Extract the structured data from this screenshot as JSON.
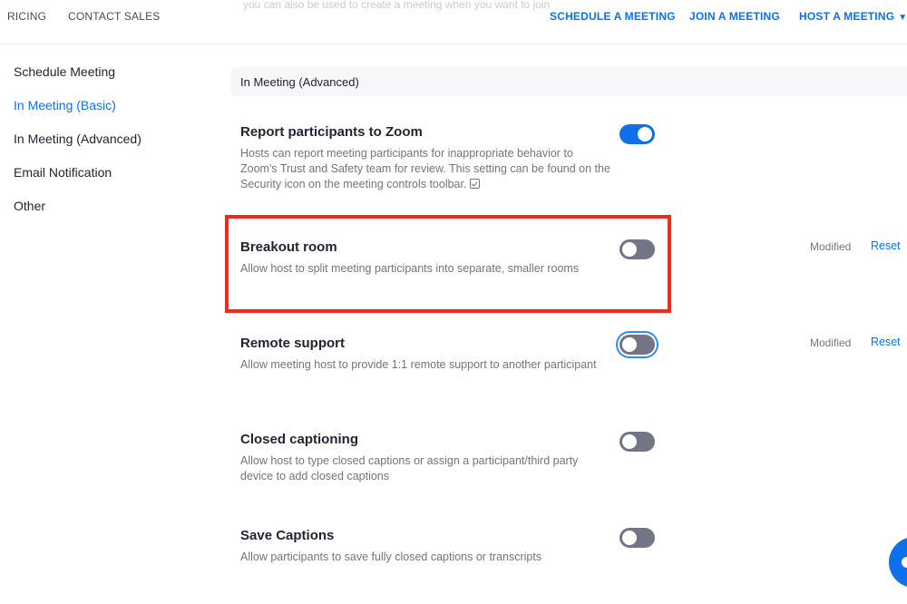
{
  "topnav": {
    "left_links": [
      "RICING",
      "CONTACT SALES"
    ],
    "right_links": [
      "SCHEDULE A MEETING",
      "JOIN A MEETING",
      "HOST A MEETING"
    ],
    "faded_banner_text": "you can also be used to create a meeting when you want to join"
  },
  "sidebar": {
    "items": [
      {
        "label": "Schedule Meeting",
        "active": false
      },
      {
        "label": "In Meeting (Basic)",
        "active": true
      },
      {
        "label": "In Meeting (Advanced)",
        "active": false
      },
      {
        "label": "Email Notification",
        "active": false
      },
      {
        "label": "Other",
        "active": false
      }
    ]
  },
  "section": {
    "title": "In Meeting (Advanced)"
  },
  "settings": [
    {
      "title": "Report participants to Zoom",
      "description": "Hosts can report meeting participants for inappropriate behavior to Zoom's Trust and Safety team for review. This setting can be found on the Security icon on the meeting controls toolbar.",
      "enabled": true
    },
    {
      "title": "Breakout room",
      "description": "Allow host to split meeting participants into separate, smaller rooms",
      "enabled": false,
      "modified_label": "Modified",
      "reset_label": "Reset"
    },
    {
      "title": "Remote support",
      "description": "Allow meeting host to provide 1:1 remote support to another participant",
      "enabled": false,
      "modified_label": "Modified",
      "reset_label": "Reset"
    },
    {
      "title": "Closed captioning",
      "description": "Allow host to type closed captions or assign a participant/third party device to add closed captions",
      "enabled": false
    },
    {
      "title": "Save Captions",
      "description": "Allow participants to save fully closed captions or transcripts",
      "enabled": false
    }
  ],
  "colors": {
    "accent": "#0e71eb",
    "toggle_off": "#747487",
    "highlight": "#ee2b16"
  },
  "icons": {
    "host_caret": "caret-down-icon",
    "security_inline": "security-icon",
    "chat": "chat-bubble-icon"
  }
}
